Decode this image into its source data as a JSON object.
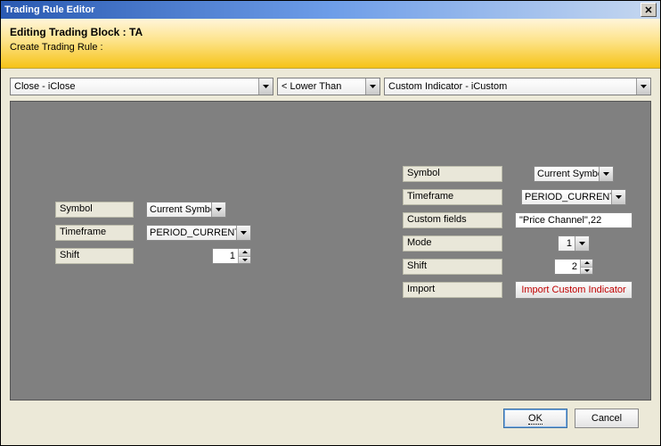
{
  "title": "Trading Rule Editor",
  "header": {
    "title": "Editing Trading Block : TA",
    "sub": "Create Trading Rule :"
  },
  "combos": {
    "left": "Close - iClose",
    "op": "< Lower Than",
    "right": "Custom Indicator - iCustom"
  },
  "leftGroup": {
    "labels": {
      "symbol": "Symbol",
      "timeframe": "Timeframe",
      "shift": "Shift"
    },
    "values": {
      "symbol": "Current Symbol",
      "timeframe": "PERIOD_CURRENT",
      "shift": "1"
    }
  },
  "rightGroup": {
    "labels": {
      "symbol": "Symbol",
      "timeframe": "Timeframe",
      "custom": "Custom fields",
      "mode": "Mode",
      "shift": "Shift",
      "import": "Import"
    },
    "values": {
      "symbol": "Current Symbol",
      "timeframe": "PERIOD_CURRENT",
      "custom": "\"Price Channel\",22",
      "mode": "1",
      "shift": "2"
    },
    "importBtn": "Import Custom Indicator"
  },
  "footer": {
    "ok": "OK",
    "cancel": "Cancel"
  }
}
